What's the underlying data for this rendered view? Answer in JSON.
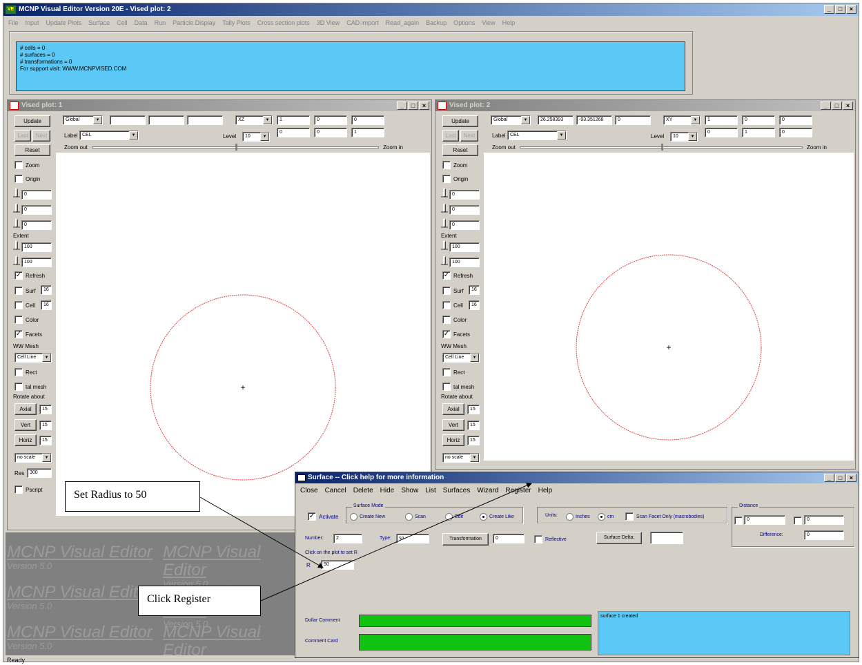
{
  "app": {
    "icon_text": "VE",
    "title": "MCNP Visual Editor Version 20E - Vised plot: 2",
    "menu": [
      "File",
      "Input",
      "Update Plots",
      "Surface",
      "Cell",
      "Data",
      "Run",
      "Particle Display",
      "Tally Plots",
      "Cross section plots",
      "3D View",
      "CAD import",
      "Read_again",
      "Backup",
      "Options",
      "View",
      "Help"
    ],
    "info_lines": [
      "# cells = 0",
      "# surfaces = 0",
      "# transformations = 0",
      "For support visit: WWW.MCNPVISED.COM"
    ],
    "status": "Ready",
    "info_color": "#5bc8f5"
  },
  "plot1": {
    "title": "Vised plot: 1",
    "update": "Update",
    "last": "Last",
    "next": "Next",
    "reset": "Reset",
    "zoom": "Zoom",
    "origin": "Origin",
    "origin_vals": [
      "0",
      "0",
      "0"
    ],
    "extent_label": "Extent",
    "extent_vals": [
      "100",
      "100"
    ],
    "refresh": "Refresh",
    "surf": "Surf",
    "surf_val": "16",
    "cell": "Cell",
    "cell_val": "16",
    "color": "Color",
    "facets": "Facets",
    "mesh_label": "WW Mesh",
    "mesh_value": "Cell Line",
    "rect": "Rect",
    "tal_mesh": "tal mesh",
    "rotate_label": "Rotate about",
    "axial": "Axial",
    "axial_val": "15",
    "vert": "Vert",
    "vert_val": "15",
    "horiz": "Horiz",
    "horiz_val": "15",
    "scale_value": "no scale",
    "res_label": "Res",
    "res_val": "300",
    "pscript": "Pscript",
    "coord_system": "Global",
    "coords": [
      "",
      "",
      ""
    ],
    "label_text": "Label",
    "label_value": "CEL",
    "plane": "XZ",
    "basis_row1": [
      "1",
      "0",
      "0"
    ],
    "basis_row2": [
      "0",
      "0",
      "1"
    ],
    "level_label": "Level",
    "level_value": "10",
    "zoom_out": "Zoom out",
    "zoom_in": "Zoom in",
    "center_mark": "+"
  },
  "plot2": {
    "title": "Vised plot: 2",
    "update": "Update",
    "last": "Last",
    "next": "Next",
    "reset": "Reset",
    "zoom": "Zoom",
    "origin": "Origin",
    "origin_vals": [
      "0",
      "0",
      "0"
    ],
    "extent_label": "Extent",
    "extent_vals": [
      "100",
      "100"
    ],
    "refresh": "Refresh",
    "surf": "Surf",
    "surf_val": "16",
    "cell": "Cell",
    "cell_val": "16",
    "color": "Color",
    "facets": "Facets",
    "mesh_label": "WW Mesh",
    "mesh_value": "Cell Line",
    "rect": "Rect",
    "tal_mesh": "tal mesh",
    "rotate_label": "Rotate about",
    "axial": "Axial",
    "axial_val": "15",
    "vert": "Vert",
    "vert_val": "15",
    "horiz": "Horiz",
    "horiz_val": "15",
    "scale_value": "no scale",
    "coord_system": "Global",
    "coords": [
      "26.258393",
      "-93.351268",
      "0"
    ],
    "label_text": "Label",
    "label_value": "CEL",
    "plane": "XY",
    "basis_row1": [
      "1",
      "0",
      "0"
    ],
    "basis_row2": [
      "0",
      "1",
      "0"
    ],
    "level_label": "Level",
    "level_value": "10",
    "zoom_out": "Zoom out",
    "zoom_in": "Zoom in",
    "center_mark": "+"
  },
  "background": {
    "line1": "MCNP Visual Editor",
    "line2": "Version 5.0"
  },
  "surface": {
    "title": "Surface -- Click help for more information",
    "menu": [
      "Close",
      "Cancel",
      "Delete",
      "Hide",
      "Show",
      "List",
      "Surfaces",
      "Wizard",
      "Register",
      "Help"
    ],
    "activate": "Activate",
    "mode_group": "Surface Mode",
    "modes": [
      "Create New",
      "Scan",
      "Edit",
      "Create Like"
    ],
    "units_label": "Units:",
    "units": [
      "Inches",
      "cm"
    ],
    "scan_facet": "Scan Facet Only (macrobodies)",
    "distance_group": "Distance",
    "dist_vals": [
      "0",
      "0"
    ],
    "difference_label": "Difference:",
    "difference_val": "0",
    "number_label": "Number:",
    "number_val": "2",
    "type_label": "Type:",
    "type_val": "so",
    "transformation": "Transformation",
    "transformation_val": "0",
    "reflective": "Reflective",
    "surface_delta": "Surface Delta:",
    "surface_delta_val": "",
    "click_hint": "Click on the plot to set R",
    "r_label": "R",
    "r_val": "50",
    "dollar_comment": "Dollar Comment",
    "comment_card": "Comment Card",
    "message": "surface 1 created"
  },
  "callouts": {
    "radius": "Set Radius to 50",
    "register": "Click Register"
  }
}
